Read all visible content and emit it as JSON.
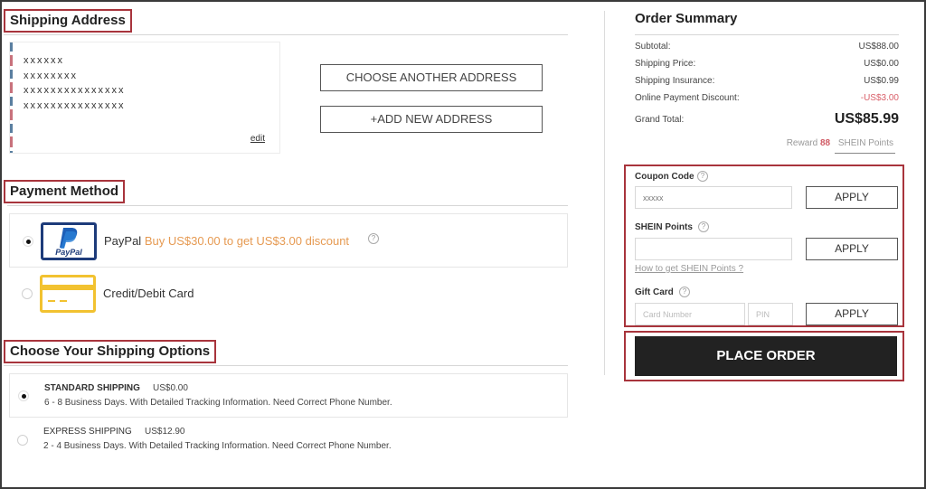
{
  "shipping_address": {
    "title": "Shipping Address",
    "lines": [
      "xxxxxx",
      "xxxxxxxx",
      "xxxxxxxxxxxxxxx",
      "xxxxxxxxxxxxxxx"
    ],
    "edit_label": "edit",
    "choose_another_label": "CHOOSE ANOTHER ADDRESS",
    "add_new_label": "+ADD NEW ADDRESS"
  },
  "payment_method": {
    "title": "Payment Method",
    "options": [
      {
        "label": "PayPal",
        "promo": "Buy US$30.00 to get US$3.00 discount",
        "selected": true,
        "icon": "paypal-icon",
        "icon_text": "PayPal"
      },
      {
        "label": "Credit/Debit Card",
        "promo": "",
        "selected": false,
        "icon": "credit-card-icon"
      }
    ],
    "help_glyph": "?"
  },
  "shipping_options": {
    "title": "Choose Your Shipping Options",
    "options": [
      {
        "name": "STANDARD SHIPPING",
        "price": "US$0.00",
        "description": "6 - 8 Business Days. With Detailed Tracking Information. Need Correct Phone Number.",
        "selected": true
      },
      {
        "name": "EXPRESS SHIPPING",
        "price": "US$12.90",
        "description": "2 - 4 Business Days. With Detailed Tracking Information. Need Correct Phone Number.",
        "selected": false
      }
    ]
  },
  "order_summary": {
    "title": "Order Summary",
    "rows": [
      {
        "label": "Subtotal:",
        "value": "US$88.00"
      },
      {
        "label": "Shipping Price:",
        "value": "US$0.00"
      },
      {
        "label": "Shipping Insurance:",
        "value": "US$0.99"
      },
      {
        "label": "Online Payment Discount:",
        "value": "-US$3.00"
      }
    ],
    "grand_total_label": "Grand Total:",
    "grand_total_value": "US$85.99",
    "reward_prefix": "Reward",
    "reward_points": "88",
    "reward_suffix": "SHEIN Points",
    "discount_color": "#d9606a"
  },
  "promotions": {
    "coupon_label": "Coupon Code",
    "coupon_value": "xxxxx",
    "shein_points_label": "SHEIN Points",
    "shein_points_value": "",
    "shein_points_help_link": "How to get SHEIN Points ?",
    "gift_card_label": "Gift Card",
    "card_number_placeholder": "Card Number",
    "pin_placeholder": "PIN",
    "apply_label": "APPLY"
  },
  "place_order_label": "PLACE ORDER",
  "colors": {
    "highlight_border": "#a8343c",
    "promo_text": "#e69a52",
    "place_order_bg": "#222222",
    "paypal_blue": "#1d3b7a",
    "card_yellow": "#f2c230"
  }
}
